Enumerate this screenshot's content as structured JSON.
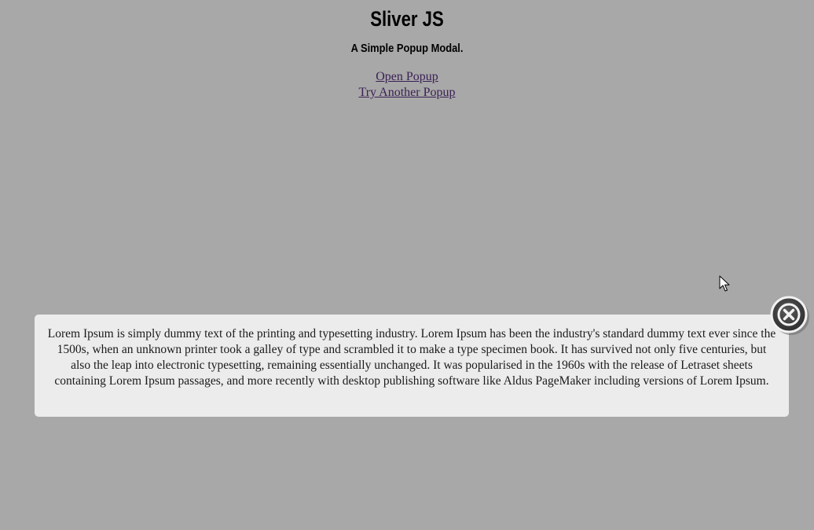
{
  "header": {
    "title": "Sliver JS",
    "subtitle": "A Simple Popup Modal."
  },
  "links": [
    {
      "label": "Open Popup"
    },
    {
      "label": "Try Another Popup"
    }
  ],
  "modal": {
    "text": "Lorem Ipsum is simply dummy text of the printing and typesetting industry. Lorem Ipsum has been the industry's standard dummy text ever since the 1500s, when an unknown printer took a galley of type and scrambled it to make a type specimen book. It has survived not only five centuries, but also the leap into electronic typesetting, remaining essentially unchanged. It was popularised in the 1960s with the release of Letraset sheets containing Lorem Ipsum passages, and more recently with desktop publishing software like Aldus PageMaker including versions of Lorem Ipsum.",
    "close_icon": "close-circle-icon"
  },
  "colors": {
    "overlay_background": "#a8a8a8",
    "modal_background": "#ececec",
    "link": "#3a1f55",
    "close_button": "#3d3d3d"
  }
}
